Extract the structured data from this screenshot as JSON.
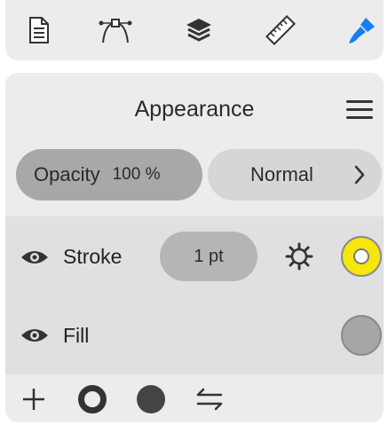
{
  "toolbar": {
    "tools": [
      {
        "icon": "document-icon",
        "active": false
      },
      {
        "icon": "vector-path-icon",
        "active": false
      },
      {
        "icon": "layers-icon",
        "active": false
      },
      {
        "icon": "ruler-icon",
        "active": false
      },
      {
        "icon": "brush-icon",
        "active": true
      }
    ]
  },
  "appearance": {
    "title": "Appearance",
    "menu_icon": "hamburger-menu-icon",
    "opacity": {
      "label": "Opacity",
      "value": "100 %"
    },
    "blend_mode": {
      "value": "Normal",
      "chevron_icon": "chevron-right-icon"
    },
    "stroke": {
      "label": "Stroke",
      "weight": "1 pt",
      "visible": true,
      "color": "#f5e60c",
      "settings_icon": "gear-icon"
    },
    "fill": {
      "label": "Fill",
      "visible": true,
      "color": "#a6a6a6"
    }
  },
  "footer": {
    "buttons": [
      "add-icon",
      "stroke-ring-icon",
      "fill-circle-icon",
      "swap-icon"
    ]
  },
  "colors": {
    "accent": "#1a7cf5",
    "panel_bg": "#ececec",
    "row_bg": "#e0e0e0"
  }
}
